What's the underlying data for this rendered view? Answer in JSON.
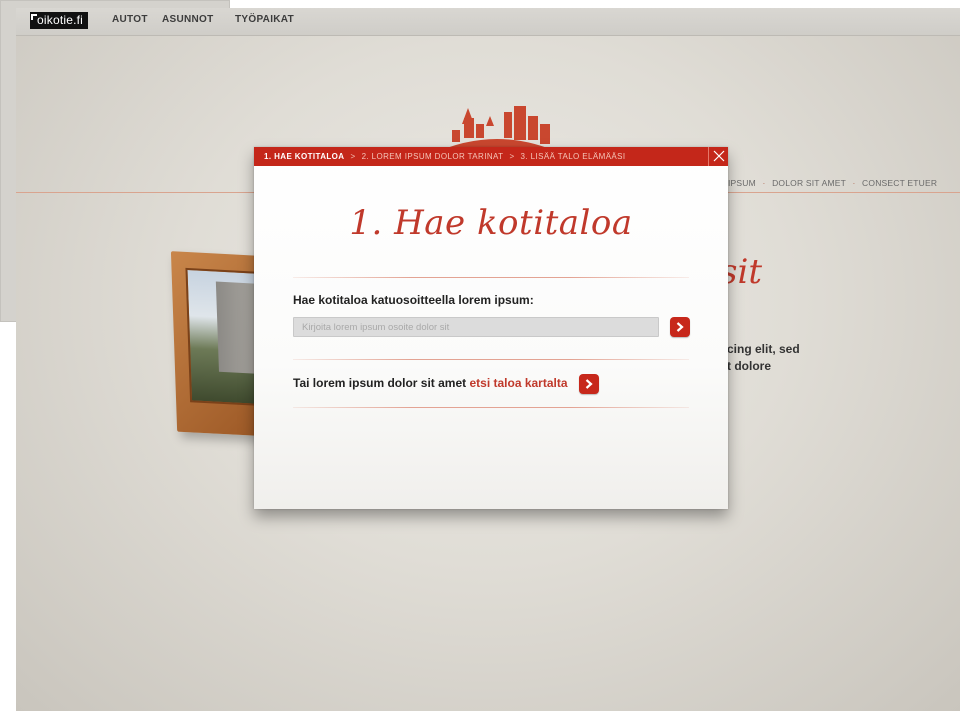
{
  "topbar": {
    "logo": "oikotie.fi",
    "nav": [
      "AUTOT",
      "ASUNNOT",
      "TYÖPAIKAT"
    ]
  },
  "background": {
    "nav_right": [
      "IPSUM",
      "DOLOR SIT AMET",
      "CONSECT ETUER"
    ],
    "heading_fragment": "sit",
    "paragraph_fragment": [
      "cing elit, sed",
      "t dolore"
    ]
  },
  "modal": {
    "steps": [
      "1. HAE KOTITALOA",
      "2. LOREM IPSUM DOLOR TARINAT",
      "3. LISÄÄ TALO ELÄMÄÄSI"
    ],
    "step_separator": ">",
    "title": "1. Hae kotitaloa",
    "search_label": "Hae kotitaloa katuosoitteella lorem ipsum:",
    "search_placeholder": "Kirjoita lorem ipsum osoite dolor sit",
    "search_value": "",
    "alt_prefix": "Tai lorem ipsum dolor sit amet ",
    "alt_link": "etsi taloa kartalta"
  },
  "colors": {
    "accent": "#c4271a",
    "text": "#222222",
    "background": "#e4e1db"
  }
}
